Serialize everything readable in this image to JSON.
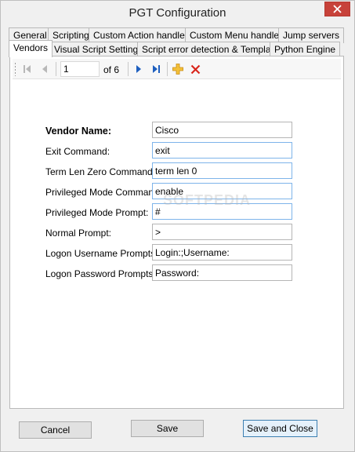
{
  "window": {
    "title": "PGT Configuration"
  },
  "tabs_row1": [
    "General",
    "Scripting",
    "Custom Action handlers",
    "Custom Menu handlers",
    "Jump servers"
  ],
  "tabs_row2": [
    "Vendors",
    "Visual Script Settings",
    "Script error detection & Templates",
    "Python Engine"
  ],
  "navigator": {
    "position": "1",
    "of_label": "of 6"
  },
  "form": {
    "vendor_name": {
      "label": "Vendor Name:",
      "value": "Cisco"
    },
    "exit_command": {
      "label": "Exit Command:",
      "value": "exit"
    },
    "term_len_zero": {
      "label": "Term Len Zero Command:",
      "value": "term len 0"
    },
    "priv_mode_command": {
      "label": "Privileged Mode Command:",
      "value": "enable"
    },
    "priv_mode_prompt": {
      "label": "Privileged Mode Prompt:",
      "value": "#"
    },
    "normal_prompt": {
      "label": "Normal Prompt:",
      "value": ">"
    },
    "logon_username_prompts": {
      "label": "Logon Username Prompts:",
      "value": "Login:;Username:"
    },
    "logon_password_prompts": {
      "label": "Logon Password Prompts:",
      "value": "Password:"
    }
  },
  "watermark": "SOFTPEDIA",
  "buttons": {
    "cancel": "Cancel",
    "save": "Save",
    "save_close": "Save and Close"
  },
  "colors": {
    "close_button": "#c7423a",
    "nav_blue": "#1e5fbf",
    "add_yellow": "#e8a317",
    "delete_red": "#d9261c"
  }
}
